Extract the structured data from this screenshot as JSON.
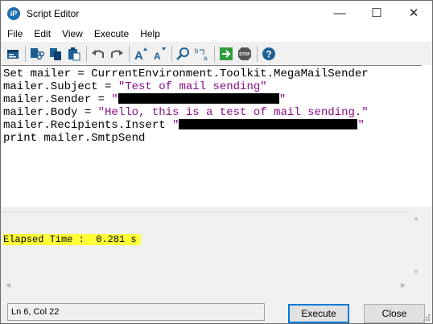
{
  "window": {
    "title": "Script Editor",
    "app_icon_label": "iP",
    "minimize_glyph": "—",
    "maximize_glyph": "☐",
    "close_glyph": "✕"
  },
  "menu": [
    "File",
    "Edit",
    "View",
    "Execute",
    "Help"
  ],
  "toolbar": {
    "icons": [
      "new-script-icon",
      "cut-icon",
      "copy-icon",
      "paste-icon",
      "undo-icon",
      "redo-icon",
      "font-increase-icon",
      "font-decrease-icon",
      "find-icon",
      "replace-icon",
      "run-icon",
      "stop-icon",
      "help-icon"
    ],
    "increase_label": "A",
    "decrease_label": "A",
    "stop_label": "STOP",
    "help_label": "?",
    "replace_label": "b a"
  },
  "editor": {
    "line1": "Set mailer = CurrentEnvironment.Toolkit.MegaMailSender",
    "line2_prefix": "mailer.Subject = ",
    "line2_string": "\"Test of mail sending\"",
    "line3_prefix": "mailer.Sender = ",
    "line3_open": "\"",
    "line3_close": "\"",
    "line4_prefix": "mailer.Body = ",
    "line4_string": "\"Hello, this is a test of mail sending.\"",
    "line5_prefix": "mailer.Recipients.Insert ",
    "line5_open": "\"",
    "line5_close": "\"",
    "line6": "print mailer.SmtpSend"
  },
  "output": {
    "text": "Elapsed Time :  0.281 s",
    "highlight_color": "#ffff38"
  },
  "status": {
    "position": "Ln 6, Col 22"
  },
  "buttons": {
    "execute": "Execute",
    "close": "Close"
  },
  "colors": {
    "string": "#8b0f8b",
    "accent": "#0078d7"
  }
}
